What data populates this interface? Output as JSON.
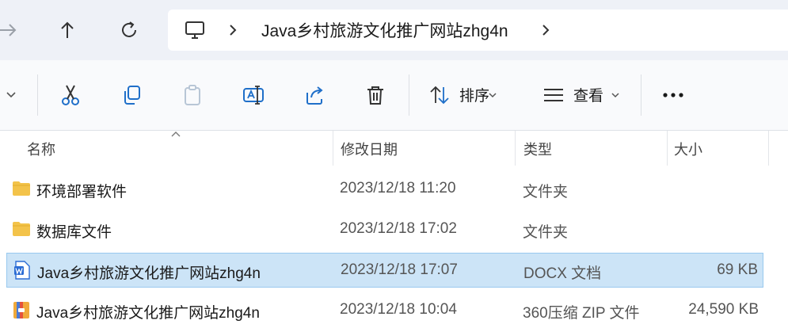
{
  "nav": {
    "path_item": "Java乡村旅游文化推广网站zhg4n"
  },
  "toolbar": {
    "sort_label": "排序",
    "view_label": "查看"
  },
  "columns": {
    "name": "名称",
    "date": "修改日期",
    "type": "类型",
    "size": "大小"
  },
  "files": [
    {
      "name": "环境部署软件",
      "date": "2023/12/18 11:20",
      "type": "文件夹",
      "size": "",
      "icon": "folder-icon",
      "selected": false
    },
    {
      "name": "数据库文件",
      "date": "2023/12/18 17:02",
      "type": "文件夹",
      "size": "",
      "icon": "folder-icon",
      "selected": false
    },
    {
      "name": "Java乡村旅游文化推广网站zhg4n",
      "date": "2023/12/18 17:07",
      "type": "DOCX 文档",
      "size": "69 KB",
      "icon": "word-doc-icon",
      "selected": true
    },
    {
      "name": "Java乡村旅游文化推广网站zhg4n",
      "date": "2023/12/18 10:04",
      "type": "360压缩 ZIP 文件",
      "size": "24,590 KB",
      "icon": "zip-archive-icon",
      "selected": false
    }
  ],
  "colors": {
    "selection_bg": "#cce4f7",
    "selection_border": "#99c9ef",
    "folder": "#f3c34a",
    "word": "#2b6cd4"
  }
}
